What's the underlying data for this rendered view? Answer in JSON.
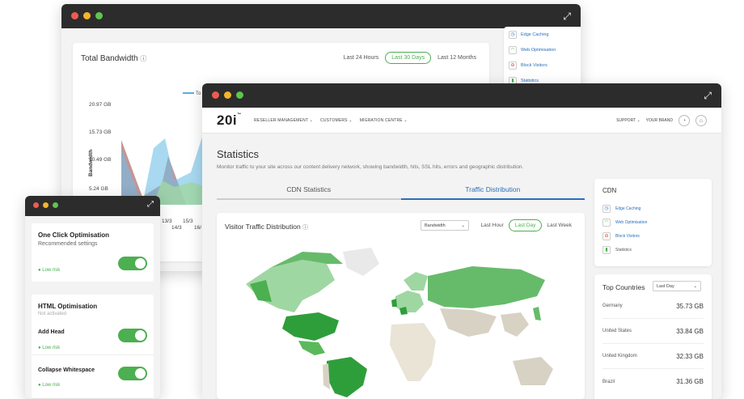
{
  "bandwidth_window": {
    "title": "Total Bandwidth",
    "ranges": [
      "Last 24 Hours",
      "Last 30 Days",
      "Last 12 Months"
    ],
    "active_range": "Last 30 Days",
    "legend_fragment": "To",
    "y_axis_label": "Bandwidth",
    "y_ticks": [
      "20.97 GB",
      "15.73 GB",
      "10.49 GB",
      "5.24 GB"
    ],
    "x_ticks": [
      "13/3",
      "15/3",
      "14/3",
      "16/"
    ],
    "side_items": [
      "Edge Caching",
      "Web Optimisation",
      "Block Visitors",
      "Statistics"
    ]
  },
  "main_window": {
    "brand": "20i",
    "nav_menu": [
      "RESELLER MANAGEMENT",
      "CUSTOMERS",
      "MIGRATION CENTRE"
    ],
    "nav_right": [
      "SUPPORT",
      "YOUR BRAND"
    ],
    "page_title": "Statistics",
    "page_desc": "Monitor traffic to your site across our content delivery network, showing bandwidth, hits, SSL hits, errors and geographic distribution.",
    "tabs": [
      "CDN Statistics",
      "Traffic Distribution"
    ],
    "active_tab": "Traffic Distribution",
    "viz": {
      "title": "Visitor Traffic Distribution",
      "select": "Bandwidth",
      "ranges": [
        "Last Hour",
        "Last Day",
        "Last Week"
      ],
      "active_range": "Last Day"
    },
    "cdn": {
      "title": "CDN",
      "items": [
        "Edge Caching",
        "Web Optimisation",
        "Block Visitors",
        "Statistics"
      ]
    },
    "top_countries": {
      "title": "Top Countries",
      "select": "Last Day",
      "rows": [
        {
          "country": "Germany",
          "value": "35.73 GB"
        },
        {
          "country": "United States",
          "value": "33.84 GB"
        },
        {
          "country": "United Kingdom",
          "value": "32.33 GB"
        },
        {
          "country": "Brazil",
          "value": "31.36 GB"
        }
      ]
    }
  },
  "optimisation_window": {
    "one_click": {
      "title": "One Click Optimisation",
      "subtitle": "Recommended settings",
      "risk": "Low risk"
    },
    "html": {
      "title": "HTML Optimisation",
      "status": "Not activated",
      "items": [
        {
          "label": "Add Head",
          "risk": "Low risk"
        },
        {
          "label": "Collapse Whitespace",
          "risk": "Low risk"
        }
      ]
    }
  },
  "colors": {
    "accent_green": "#4caf50",
    "link_blue": "#2a6ebb",
    "titlebar": "#2c2c2c"
  }
}
